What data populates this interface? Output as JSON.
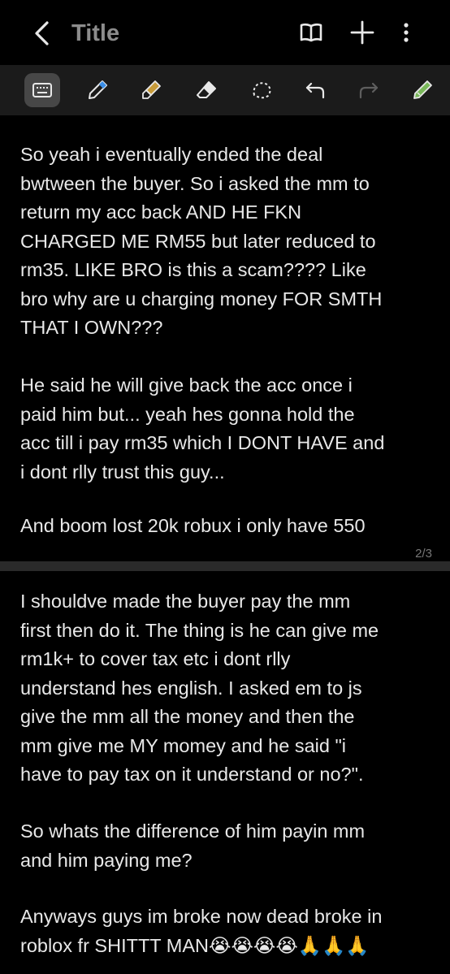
{
  "appbar": {
    "title": "Title",
    "icons": [
      "back-arrow-icon",
      "book-icon",
      "plus-icon",
      "more-vert-icon"
    ]
  },
  "toolbar": {
    "tools": [
      "keyboard-icon",
      "pen-icon",
      "highlighter-icon",
      "eraser-icon",
      "lasso-icon",
      "undo-icon",
      "redo-icon",
      "pen-settings-icon"
    ],
    "active": "keyboard-icon"
  },
  "page1": {
    "p1": "So yeah i eventually ended the deal\nbwtween the buyer. So i asked the mm to\nreturn my acc back AND HE FKN\nCHARGED ME RM55 but later reduced to\nrm35. LIKE BRO is this a scam???? Like\nbro why are u charging money FOR SMTH\nTHAT I OWN???",
    "p2": "He said he will give back the acc once i\npaid him but... yeah hes gonna hold the\nacc till i pay rm35 which I DONT HAVE and\ni dont rlly trust this guy...",
    "p3": "And boom lost 20k robux i only have 550"
  },
  "page_indicator": "2/3",
  "page2": {
    "p1": "I shouldve made the buyer pay the mm\nfirst then do it. The thing is he can give me\nrm1k+ to cover tax etc i dont rlly\nunderstand hes english. I asked em to js\ngive the mm all the money and then the\nmm give me MY momey and he said \"i\nhave to pay tax on it understand or no?\".",
    "p2": "So whats the difference of him payin mm\nand him paying me?",
    "p3": "Anyways guys im broke now dead broke in\nroblox fr SHITTT MAN😭😭😭😭🙏🙏🙏"
  }
}
